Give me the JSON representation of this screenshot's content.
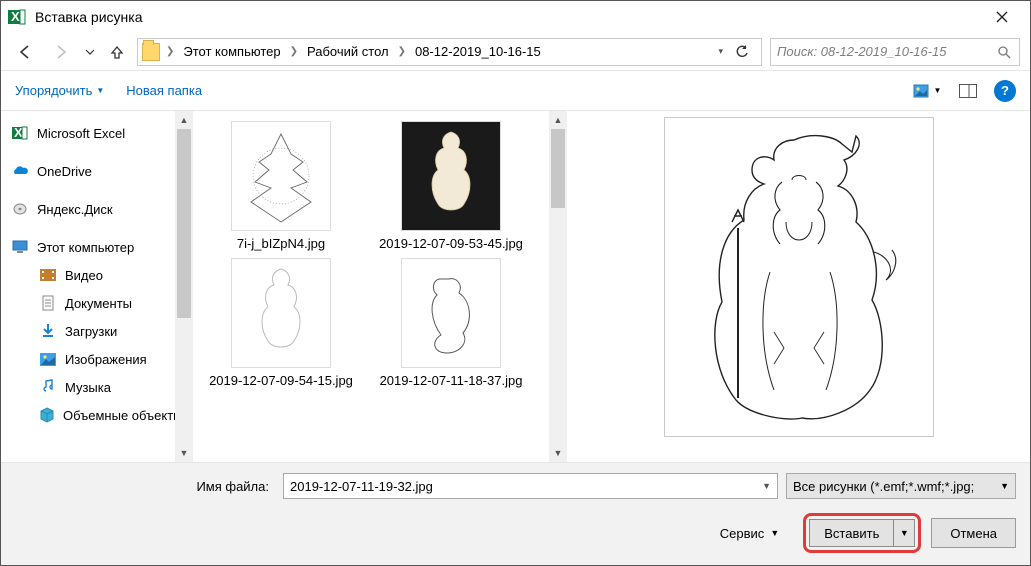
{
  "title": "Вставка рисунка",
  "breadcrumb": {
    "segments": [
      "Этот компьютер",
      "Рабочий стол",
      "08-12-2019_10-16-15"
    ]
  },
  "search": {
    "placeholder": "Поиск: 08-12-2019_10-16-15"
  },
  "toolbar": {
    "organize": "Упорядочить",
    "new_folder": "Новая папка"
  },
  "sidebar": {
    "items": [
      {
        "label": "Microsoft Excel",
        "icon": "excel"
      },
      {
        "label": "OneDrive",
        "icon": "onedrive"
      },
      {
        "label": "Яндекс.Диск",
        "icon": "yadisk"
      },
      {
        "label": "Этот компьютер",
        "icon": "pc"
      },
      {
        "label": "Видео",
        "icon": "video"
      },
      {
        "label": "Документы",
        "icon": "docs"
      },
      {
        "label": "Загрузки",
        "icon": "downloads"
      },
      {
        "label": "Изображения",
        "icon": "pictures"
      },
      {
        "label": "Музыка",
        "icon": "music"
      },
      {
        "label": "Объемные объекты",
        "icon": "3d"
      }
    ]
  },
  "files": [
    {
      "name": "7i-j_bIZpN4.jpg",
      "thumb_style": "tree"
    },
    {
      "name": "2019-12-07-09-53-45.jpg",
      "thumb_style": "dark"
    },
    {
      "name": "2019-12-07-09-54-15.jpg",
      "thumb_style": "maiden"
    },
    {
      "name": "2019-12-07-11-18-37.jpg",
      "thumb_style": "sketch"
    }
  ],
  "preview_of": "2019-12-07-11-19-32.jpg",
  "bottom": {
    "filename_label": "Имя файла:",
    "filename_value": "2019-12-07-11-19-32.jpg",
    "filter": "Все рисунки (*.emf;*.wmf;*.jpg;",
    "tools": "Сервис",
    "insert": "Вставить",
    "cancel": "Отмена"
  }
}
